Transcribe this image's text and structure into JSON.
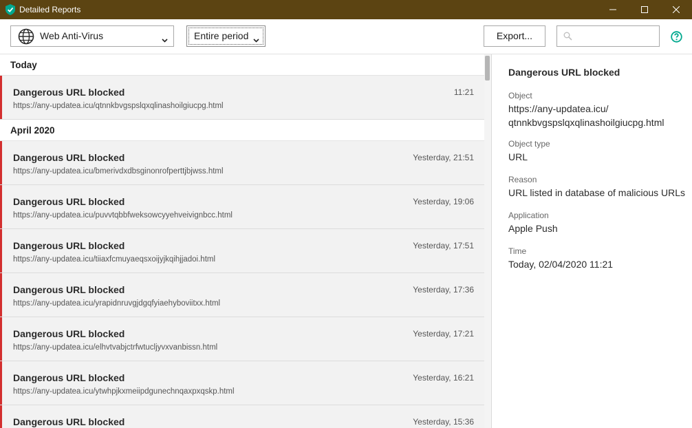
{
  "window": {
    "title": "Detailed Reports",
    "controls": [
      "minimize-icon",
      "maximize-icon",
      "close-icon"
    ]
  },
  "toolbar": {
    "component": "Web Anti-Virus",
    "period": "Entire period",
    "export_label": "Export...",
    "search_placeholder": "",
    "help_icon": "help-icon"
  },
  "groups": [
    {
      "label": "Today",
      "items": [
        {
          "title": "Dangerous URL blocked",
          "url": "https://any-updatea.icu/qtnnkbvgspslqxqlinashoilgiucpg.html",
          "time": "11:21"
        }
      ]
    },
    {
      "label": "April 2020",
      "items": [
        {
          "title": "Dangerous URL blocked",
          "url": "https://any-updatea.icu/bmerivdxdbsginonrofperttjbjwss.html",
          "time": "Yesterday, 21:51"
        },
        {
          "title": "Dangerous URL blocked",
          "url": "https://any-updatea.icu/puvvtqbbfweksowcyyehveivignbcc.html",
          "time": "Yesterday, 19:06"
        },
        {
          "title": "Dangerous URL blocked",
          "url": "https://any-updatea.icu/tiiaxfcmuyaeqsxoijyjkqihjjadoi.html",
          "time": "Yesterday, 17:51"
        },
        {
          "title": "Dangerous URL blocked",
          "url": "https://any-updatea.icu/yrapidnruvgjdgqfyiaehyboviitxx.html",
          "time": "Yesterday, 17:36"
        },
        {
          "title": "Dangerous URL blocked",
          "url": "https://any-updatea.icu/elhvtvabjctrfwtucljyvxvanbissn.html",
          "time": "Yesterday, 17:21"
        },
        {
          "title": "Dangerous URL blocked",
          "url": "https://any-updatea.icu/ytwhpjkxmeiipdgunechnqaxpxqskp.html",
          "time": "Yesterday, 16:21"
        },
        {
          "title": "Dangerous URL blocked",
          "url": "",
          "time": "Yesterday, 15:36"
        }
      ]
    }
  ],
  "details": {
    "title": "Dangerous URL blocked",
    "object_label": "Object",
    "object_value_line1": "https://any-updatea.icu/",
    "object_value_line2": "qtnnkbvgspslqxqlinashoilgiucpg.html",
    "type_label": "Object type",
    "type_value": "URL",
    "reason_label": "Reason",
    "reason_value": "URL listed in database of malicious URLs",
    "app_label": "Application",
    "app_value": "Apple Push",
    "time_label": "Time",
    "time_value": "Today, 02/04/2020 11:21"
  },
  "colors": {
    "titlebar": "#5c4412",
    "accent_red": "#d32f2f",
    "accent_green": "#00a88e"
  }
}
